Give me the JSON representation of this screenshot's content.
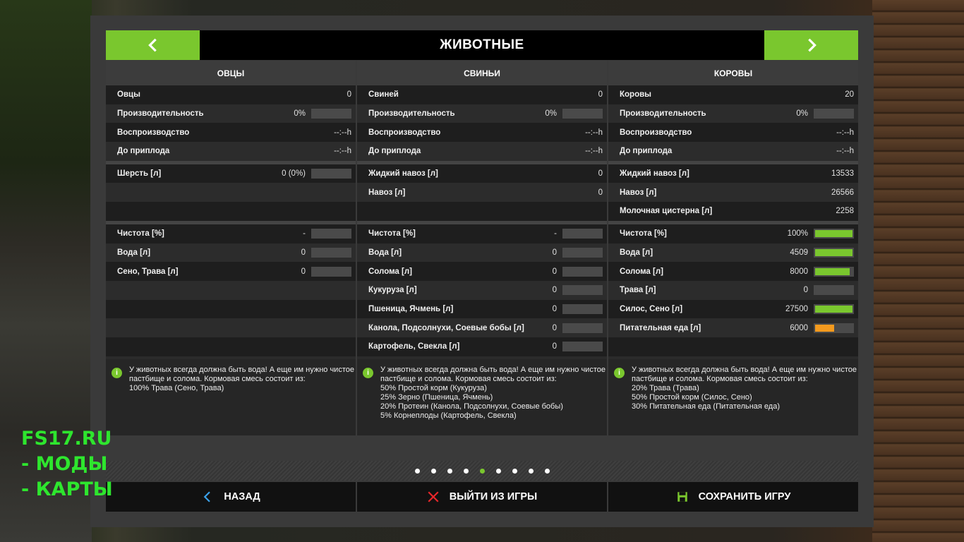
{
  "header": {
    "title": "ЖИВОТНЫЕ"
  },
  "columns": [
    {
      "title": "ОВЦЫ",
      "groups": [
        [
          {
            "label": "Овцы",
            "value": "0"
          },
          {
            "label": "Производительность",
            "value": "0%",
            "bar": 0
          },
          {
            "label": "Воспроизводство",
            "value": "--:--h"
          },
          {
            "label": "До приплода",
            "value": "--:--h"
          }
        ],
        [
          {
            "label": "Шерсть [л]",
            "value": "0 (0%)",
            "bar": 0
          },
          {
            "label": "",
            "value": ""
          },
          {
            "label": "",
            "value": ""
          }
        ],
        [
          {
            "label": "Чистота [%]",
            "value": "-",
            "bar": 0
          },
          {
            "label": "Вода [л]",
            "value": "0",
            "bar": 0
          },
          {
            "label": "Сено, Трава [л]",
            "value": "0",
            "bar": 0
          },
          {
            "label": "",
            "value": ""
          },
          {
            "label": "",
            "value": ""
          },
          {
            "label": "",
            "value": ""
          },
          {
            "label": "",
            "value": ""
          }
        ]
      ],
      "info": "У животных всегда должна быть вода! А еще им нужно чистое пастбище и солома. Кормовая смесь состоит из:\n100% Трава (Сено, Трава)"
    },
    {
      "title": "СВИНЬИ",
      "groups": [
        [
          {
            "label": "Свиней",
            "value": "0"
          },
          {
            "label": "Производительность",
            "value": "0%",
            "bar": 0
          },
          {
            "label": "Воспроизводство",
            "value": "--:--h"
          },
          {
            "label": "До приплода",
            "value": "--:--h"
          }
        ],
        [
          {
            "label": "Жидкий навоз [л]",
            "value": "0"
          },
          {
            "label": "Навоз [л]",
            "value": "0"
          },
          {
            "label": "",
            "value": ""
          }
        ],
        [
          {
            "label": "Чистота [%]",
            "value": "-",
            "bar": 0
          },
          {
            "label": "Вода [л]",
            "value": "0",
            "bar": 0
          },
          {
            "label": "Солома [л]",
            "value": "0",
            "bar": 0
          },
          {
            "label": "Кукуруза [л]",
            "value": "0",
            "bar": 0
          },
          {
            "label": "Пшеница, Ячмень [л]",
            "value": "0",
            "bar": 0
          },
          {
            "label": "Канола, Подсолнухи, Соевые бобы [л]",
            "value": "0",
            "bar": 0
          },
          {
            "label": "Картофель, Свекла [л]",
            "value": "0",
            "bar": 0
          }
        ]
      ],
      "info": "У животных всегда должна быть вода! А еще им нужно чистое пастбище и солома. Кормовая смесь состоит из:\n50% Простой корм (Кукуруза)\n25% Зерно (Пшеница, Ячмень)\n20% Протеин (Канола, Подсолнухи, Соевые бобы)\n5% Корнеплоды (Картофель, Свекла)"
    },
    {
      "title": "КОРОВЫ",
      "groups": [
        [
          {
            "label": "Коровы",
            "value": "20"
          },
          {
            "label": "Производительность",
            "value": "0%",
            "bar": 0
          },
          {
            "label": "Воспроизводство",
            "value": "--:--h"
          },
          {
            "label": "До приплода",
            "value": "--:--h"
          }
        ],
        [
          {
            "label": "Жидкий навоз [л]",
            "value": "13533"
          },
          {
            "label": "Навоз [л]",
            "value": "26566"
          },
          {
            "label": "Молочная цистерна [л]",
            "value": "2258"
          }
        ],
        [
          {
            "label": "Чистота [%]",
            "value": "100%",
            "bar": 1.0,
            "color": "#7ac72e"
          },
          {
            "label": "Вода [л]",
            "value": "4509",
            "bar": 1.0,
            "color": "#7ac72e"
          },
          {
            "label": "Солома [л]",
            "value": "8000",
            "bar": 0.92,
            "color": "#7ac72e"
          },
          {
            "label": "Трава [л]",
            "value": "0",
            "bar": 0
          },
          {
            "label": "Силос, Сено [л]",
            "value": "27500",
            "bar": 1.0,
            "color": "#7ac72e"
          },
          {
            "label": "Питательная еда [л]",
            "value": "6000",
            "bar": 0.5,
            "color": "#f39a1e"
          },
          {
            "label": "",
            "value": ""
          }
        ]
      ],
      "info": "У животных всегда должна быть вода! А еще им нужно чистое пастбище и солома. Кормовая смесь состоит из:\n20% Трава (Трава)\n50% Простой корм (Силос, Сено)\n30% Питательная еда (Питательная еда)"
    }
  ],
  "pager": {
    "count": 9,
    "active": 4
  },
  "footer": {
    "back": "НАЗАД",
    "quit": "ВЫЙТИ ИЗ ИГРЫ",
    "save": "СОХРАНИТЬ ИГРУ"
  },
  "watermark": [
    "FS17.RU",
    "- МОДЫ",
    "- КАРТЫ"
  ],
  "colors": {
    "accent": "#7ac72e",
    "warning": "#f39a1e",
    "close": "#e8262a",
    "back": "#3aa0e8"
  }
}
